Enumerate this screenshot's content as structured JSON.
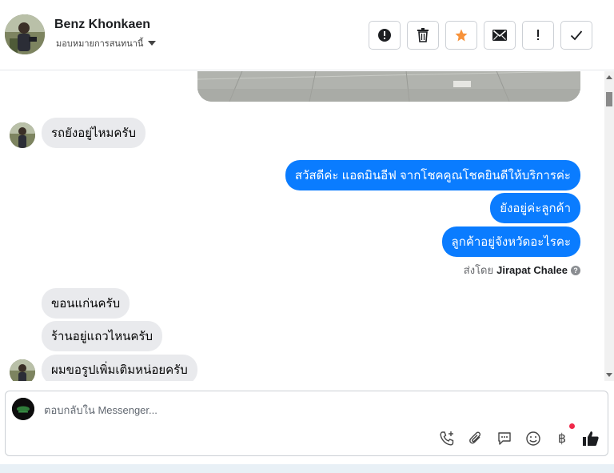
{
  "header": {
    "contact_name": "Benz Khonkaen",
    "assign_label": "มอบหมายการสนทนานี้",
    "actions": [
      {
        "name": "spam-button",
        "icon": "alert-circle-icon"
      },
      {
        "name": "delete-button",
        "icon": "trash-icon"
      },
      {
        "name": "star-button",
        "icon": "star-icon"
      },
      {
        "name": "mark-unread-button",
        "icon": "envelope-icon"
      },
      {
        "name": "follow-up-button",
        "icon": "exclamation-icon"
      },
      {
        "name": "done-button",
        "icon": "checkmark-icon"
      }
    ],
    "star_color": "#f7923a"
  },
  "messages": {
    "m1": "รถยังอยู่ไหมครับ",
    "m2": "สวัสดีค่ะ แอดมินอีฟ จากโชคคูณโชคยินดีให้บริการค่ะ",
    "m3": "ยังอยู่ค่ะลูกค้า",
    "m4": "ลูกค้าอยู่จังหวัดอะไรคะ",
    "m5": "ขอนแก่นครับ",
    "m6": "ร้านอยู่แถวไหนครับ",
    "m7": "ผมขอรูปเพิ่มเติมหน่อยครับ"
  },
  "sent_by": {
    "prefix": "ส่งโดย",
    "name": "Jirapat Chalee"
  },
  "composer": {
    "placeholder": "ตอบกลับใน Messenger...",
    "tools": [
      "phone-add-icon",
      "paperclip-icon",
      "chat-bubble-icon",
      "smiley-icon",
      "baht-icon",
      "thumbs-up-icon"
    ],
    "baht_symbol": "฿"
  },
  "colors": {
    "outgoing_bubble": "#0a7cff",
    "incoming_bubble": "#e9eaed"
  }
}
